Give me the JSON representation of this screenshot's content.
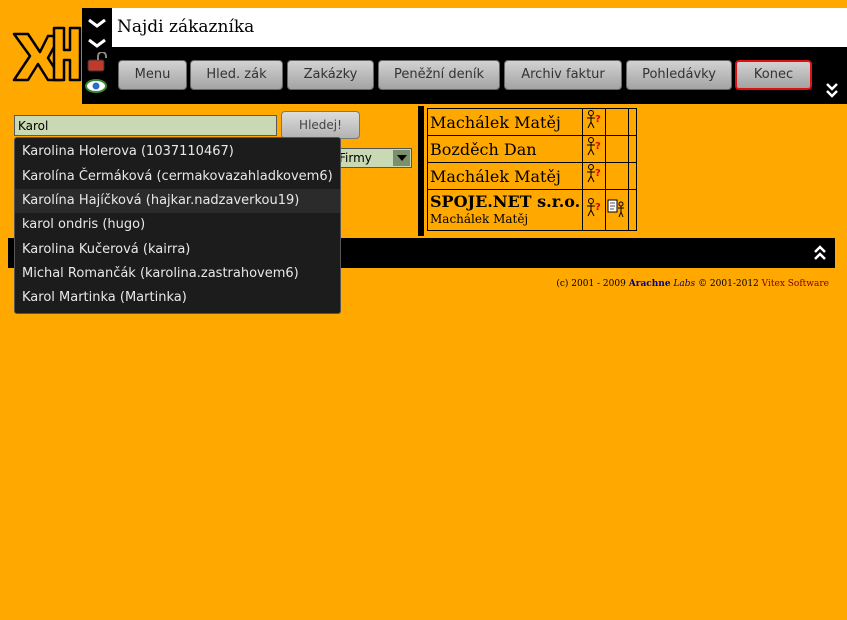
{
  "header": {
    "title": "Najdi zákazníka",
    "logo_text": "XH"
  },
  "nav": [
    {
      "label": "Menu"
    },
    {
      "label": "Hled. zák"
    },
    {
      "label": "Zakázky"
    },
    {
      "label": "Peněžní deník"
    },
    {
      "label": "Archiv faktur"
    },
    {
      "label": "Pohledávky"
    },
    {
      "label": "Konec",
      "active": true
    }
  ],
  "search": {
    "value": "Karol",
    "button": "Hledej!",
    "type_selected": "Firmy"
  },
  "autocomplete": [
    "Karolina Holerova (1037110467)",
    "Karolína Čermáková (cermakovazahladkovem6)",
    "Karolína Hajíčková (hajkar.nadzaverkou19)",
    "karol ondris (hugo)",
    "Karolina Kučerová (kairra)",
    "Michal Romančák (karolina.zastrahovem6)",
    "Karol Martinka (Martinka)"
  ],
  "results": [
    {
      "name": "Machálek Matěj"
    },
    {
      "name": "Bozděch Dan"
    },
    {
      "name": "Machálek Matěj"
    },
    {
      "name": "SPOJE.NET s.r.o.",
      "contact": "Machálek Matěj"
    }
  ],
  "footer": {
    "prefix": "(c) 2001 - 2009",
    "brand1": "Arachne",
    "brand2": "Labs",
    "middle": "© 2001-2012",
    "brand3": "Vitex Software"
  },
  "colors": {
    "background": "#ffa800",
    "bar": "#000000",
    "input": "#c9d9b4",
    "active_border": "#e01010"
  }
}
